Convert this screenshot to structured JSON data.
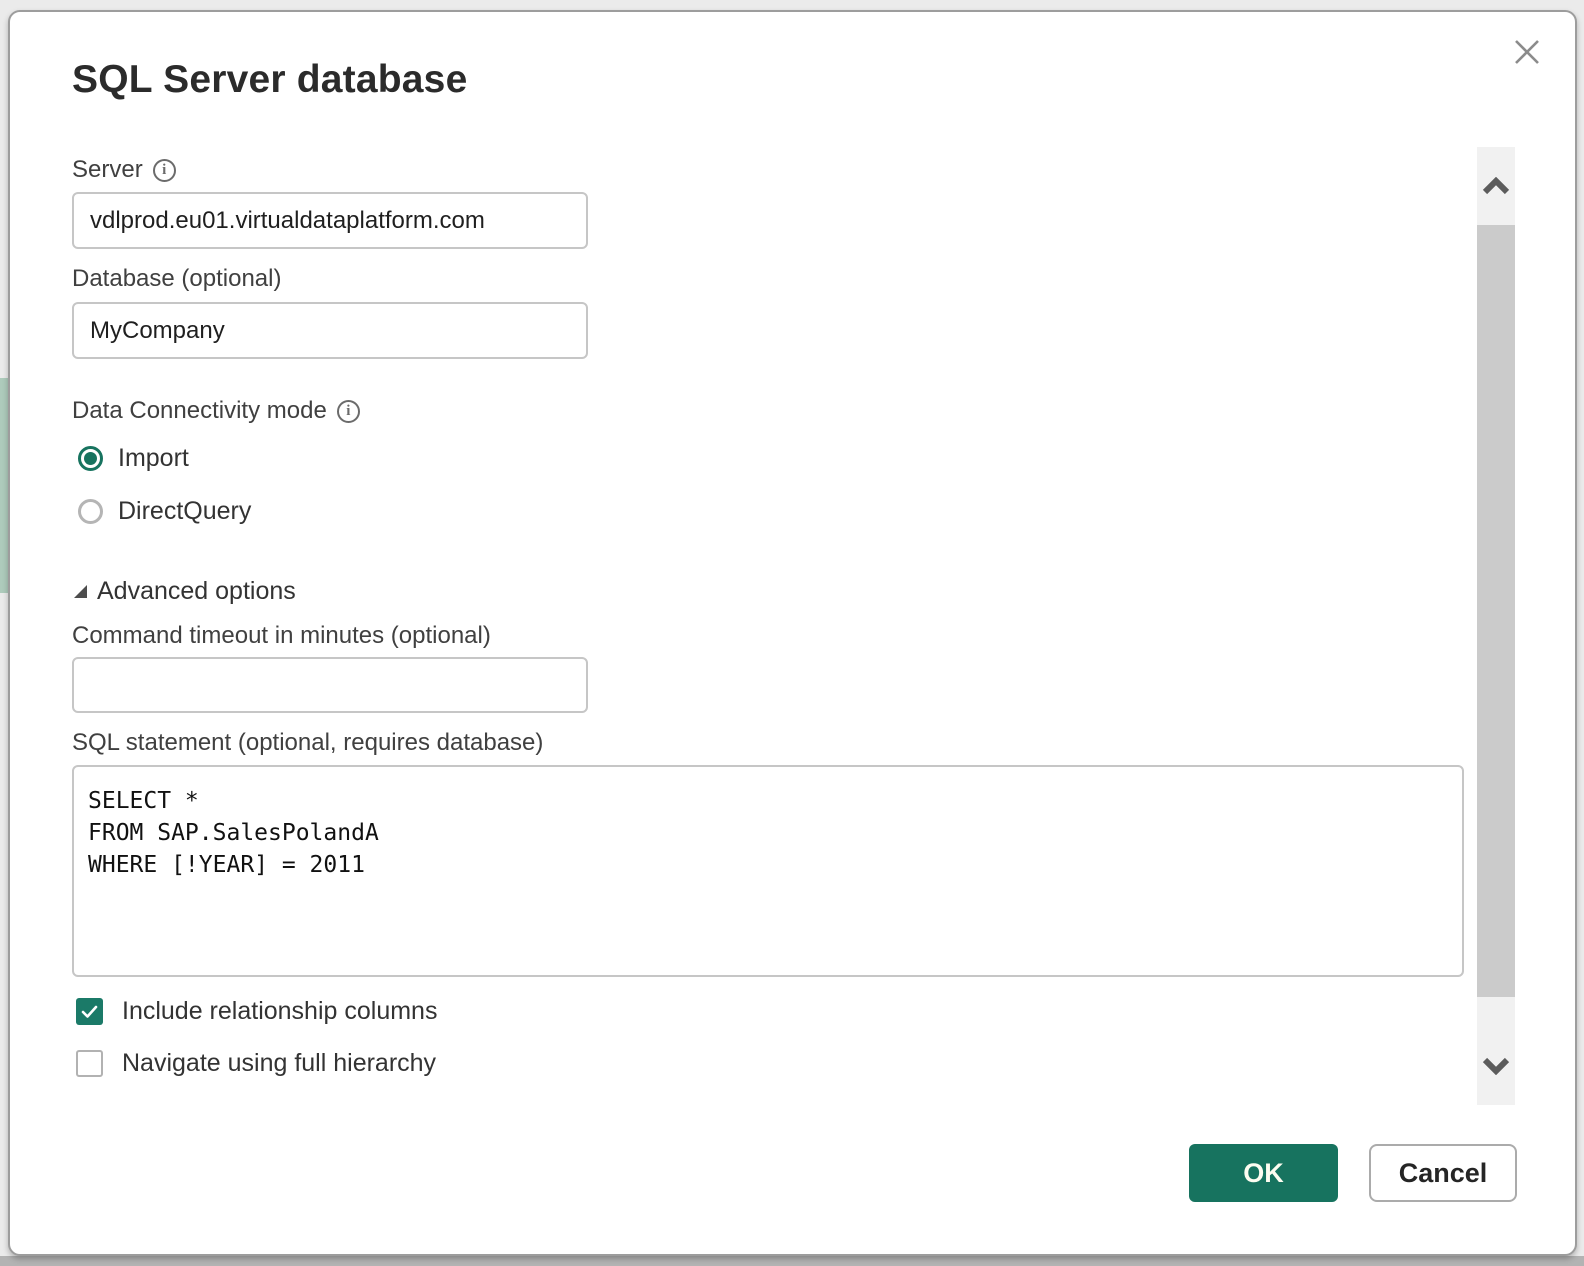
{
  "dialog": {
    "title": "SQL Server database"
  },
  "form": {
    "server": {
      "label": "Server",
      "value": "vdlprod.eu01.virtualdataplatform.com"
    },
    "database": {
      "label": "Database (optional)",
      "value": "MyCompany"
    },
    "connectivity": {
      "label": "Data Connectivity mode",
      "options": [
        {
          "label": "Import",
          "selected": true
        },
        {
          "label": "DirectQuery",
          "selected": false
        }
      ]
    },
    "advanced": {
      "label": "Advanced options",
      "expanded": true
    },
    "command_timeout": {
      "label": "Command timeout in minutes (optional)",
      "value": ""
    },
    "sql_statement": {
      "label": "SQL statement (optional, requires database)",
      "value": "SELECT *\nFROM SAP.SalesPolandA\nWHERE [!YEAR] = 2011"
    },
    "checkboxes": [
      {
        "label": "Include relationship columns",
        "checked": true
      },
      {
        "label": "Navigate using full hierarchy",
        "checked": false
      }
    ]
  },
  "buttons": {
    "ok": "OK",
    "cancel": "Cancel"
  },
  "icons": {
    "info": "i"
  },
  "colors": {
    "accent_teal": "#17735F",
    "checkbox_teal": "#1B7A68",
    "dialog_border": "#9D9D9D",
    "input_border": "#C6C6C6"
  }
}
